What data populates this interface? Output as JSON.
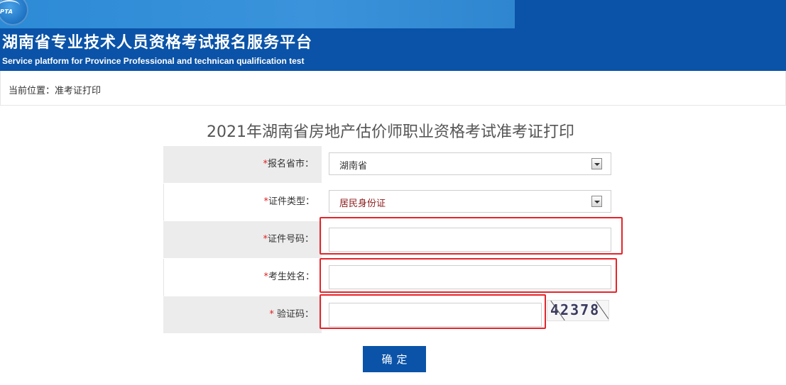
{
  "header": {
    "logo_text": "PTA",
    "title": "湖南省专业技术人员资格考试报名服务平台",
    "subtitle": "Service platform for Province Professional and technican qualification test",
    "brand_color": "#0a53a8"
  },
  "breadcrumb": {
    "text": "当前位置：准考证打印"
  },
  "page": {
    "title": "2021年湖南省房地产估价师职业资格考试准考证打印"
  },
  "form": {
    "required_mark": "*",
    "province": {
      "label": "报名省市：",
      "value": "湖南省"
    },
    "id_type": {
      "label": "证件类型：",
      "value": "居民身份证"
    },
    "id_number": {
      "label": "证件号码：",
      "value": ""
    },
    "name": {
      "label": "考生姓名：",
      "value": ""
    },
    "captcha": {
      "required_mark": "* ",
      "label": "验证码：",
      "value": "",
      "image_text": "42378"
    },
    "submit_label": "确定"
  },
  "colors": {
    "highlight": "#e4252a",
    "required": "#e02020"
  }
}
